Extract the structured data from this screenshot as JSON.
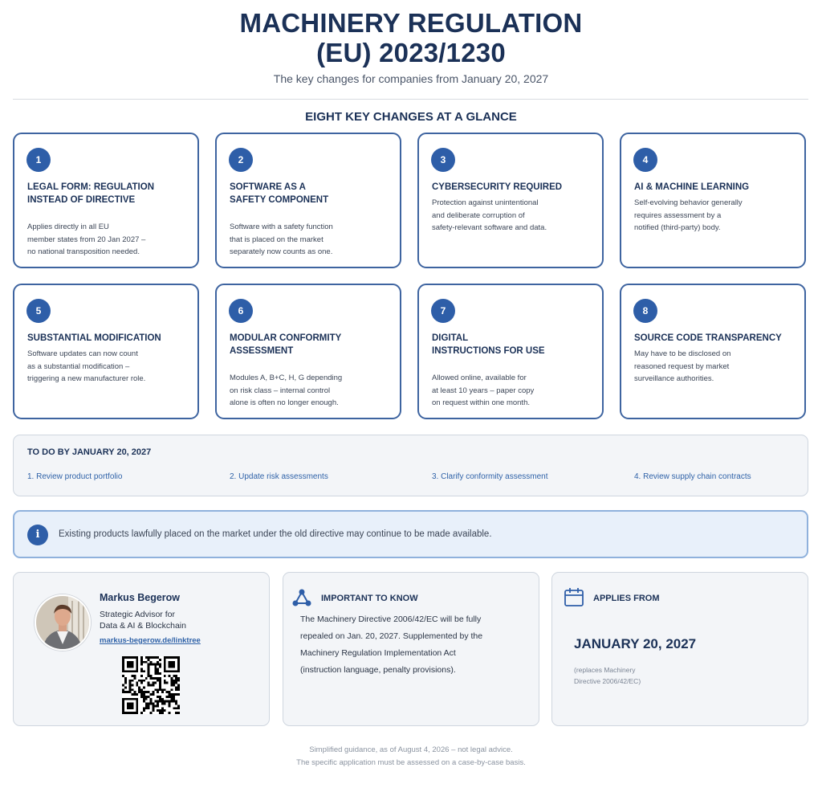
{
  "header": {
    "title_line1": "MACHINERY REGULATION",
    "title_line2": "(EU) 2023/1230",
    "subtitle": "The key changes for companies from January 20, 2027"
  },
  "section_title": "EIGHT KEY CHANGES AT A GLANCE",
  "cards": [
    {
      "number": "1",
      "title": "LEGAL FORM: REGULATION\nINSTEAD OF DIRECTIVE",
      "text": "Applies directly in all EU\nmember states from 20 Jan 2027 –\nno national transposition needed."
    },
    {
      "number": "2",
      "title": "SOFTWARE AS A\nSAFETY COMPONENT",
      "text": "Software with a safety function\nthat is placed on the market\nseparately now counts as one."
    },
    {
      "number": "3",
      "title": "CYBERSECURITY REQUIRED",
      "text": "Protection against unintentional\nand deliberate corruption of\nsafety-relevant software and data."
    },
    {
      "number": "4",
      "title": "AI & MACHINE LEARNING",
      "text": "Self-evolving behavior generally\nrequires assessment by a\nnotified (third-party) body."
    },
    {
      "number": "5",
      "title": "SUBSTANTIAL MODIFICATION",
      "text": "Software updates can now count\nas a substantial modification –\ntriggering a new manufacturer role."
    },
    {
      "number": "6",
      "title": "MODULAR CONFORMITY\nASSESSMENT",
      "text": "Modules A, B+C, H, G depending\non risk class – internal control\nalone is often no longer enough."
    },
    {
      "number": "7",
      "title": "DIGITAL\nINSTRUCTIONS FOR USE",
      "text": "Allowed online, available for\nat least 10 years – paper copy\non request within one month."
    },
    {
      "number": "8",
      "title": "SOURCE CODE TRANSPARENCY",
      "text": "May have to be disclosed on\nreasoned request by market\nsurveillance authorities."
    }
  ],
  "todo": {
    "title": "TO DO BY JANUARY 20, 2027",
    "items": [
      "1. Review product portfolio",
      "2. Update risk assessments",
      "3. Clarify conformity assessment",
      "4. Review supply chain contracts"
    ]
  },
  "info": {
    "icon": "info-icon",
    "icon_glyph": "i",
    "text": "Existing products lawfully placed on the market under the old directive may continue to be made available."
  },
  "author": {
    "name": "Markus Begerow",
    "role": "Strategic Advisor for\nData & AI & Blockchain",
    "link": "markus-begerow.de/linktree"
  },
  "important": {
    "icon": "network-icon",
    "title": "IMPORTANT TO KNOW",
    "text": "The Machinery Directive 2006/42/EC will be fully\nrepealed on Jan. 20, 2027. Supplemented by the\nMachinery Regulation Implementation Act\n(instruction language, penalty provisions)."
  },
  "applies": {
    "icon": "calendar-icon",
    "title": "APPLIES FROM",
    "date": "JANUARY 20, 2027",
    "note": "(replaces Machinery\nDirective 2006/42/EC)"
  },
  "footer": {
    "text": "Simplified guidance, as of August 4, 2026 – not legal advice.\nThe specific application must be assessed on a case-by-case basis."
  },
  "colors": {
    "navy": "#1b3157",
    "accent": "#2e5ea8",
    "card_border": "#3e64a0",
    "info_bg": "#e8f0fa",
    "panel_bg": "#f3f5f8"
  }
}
